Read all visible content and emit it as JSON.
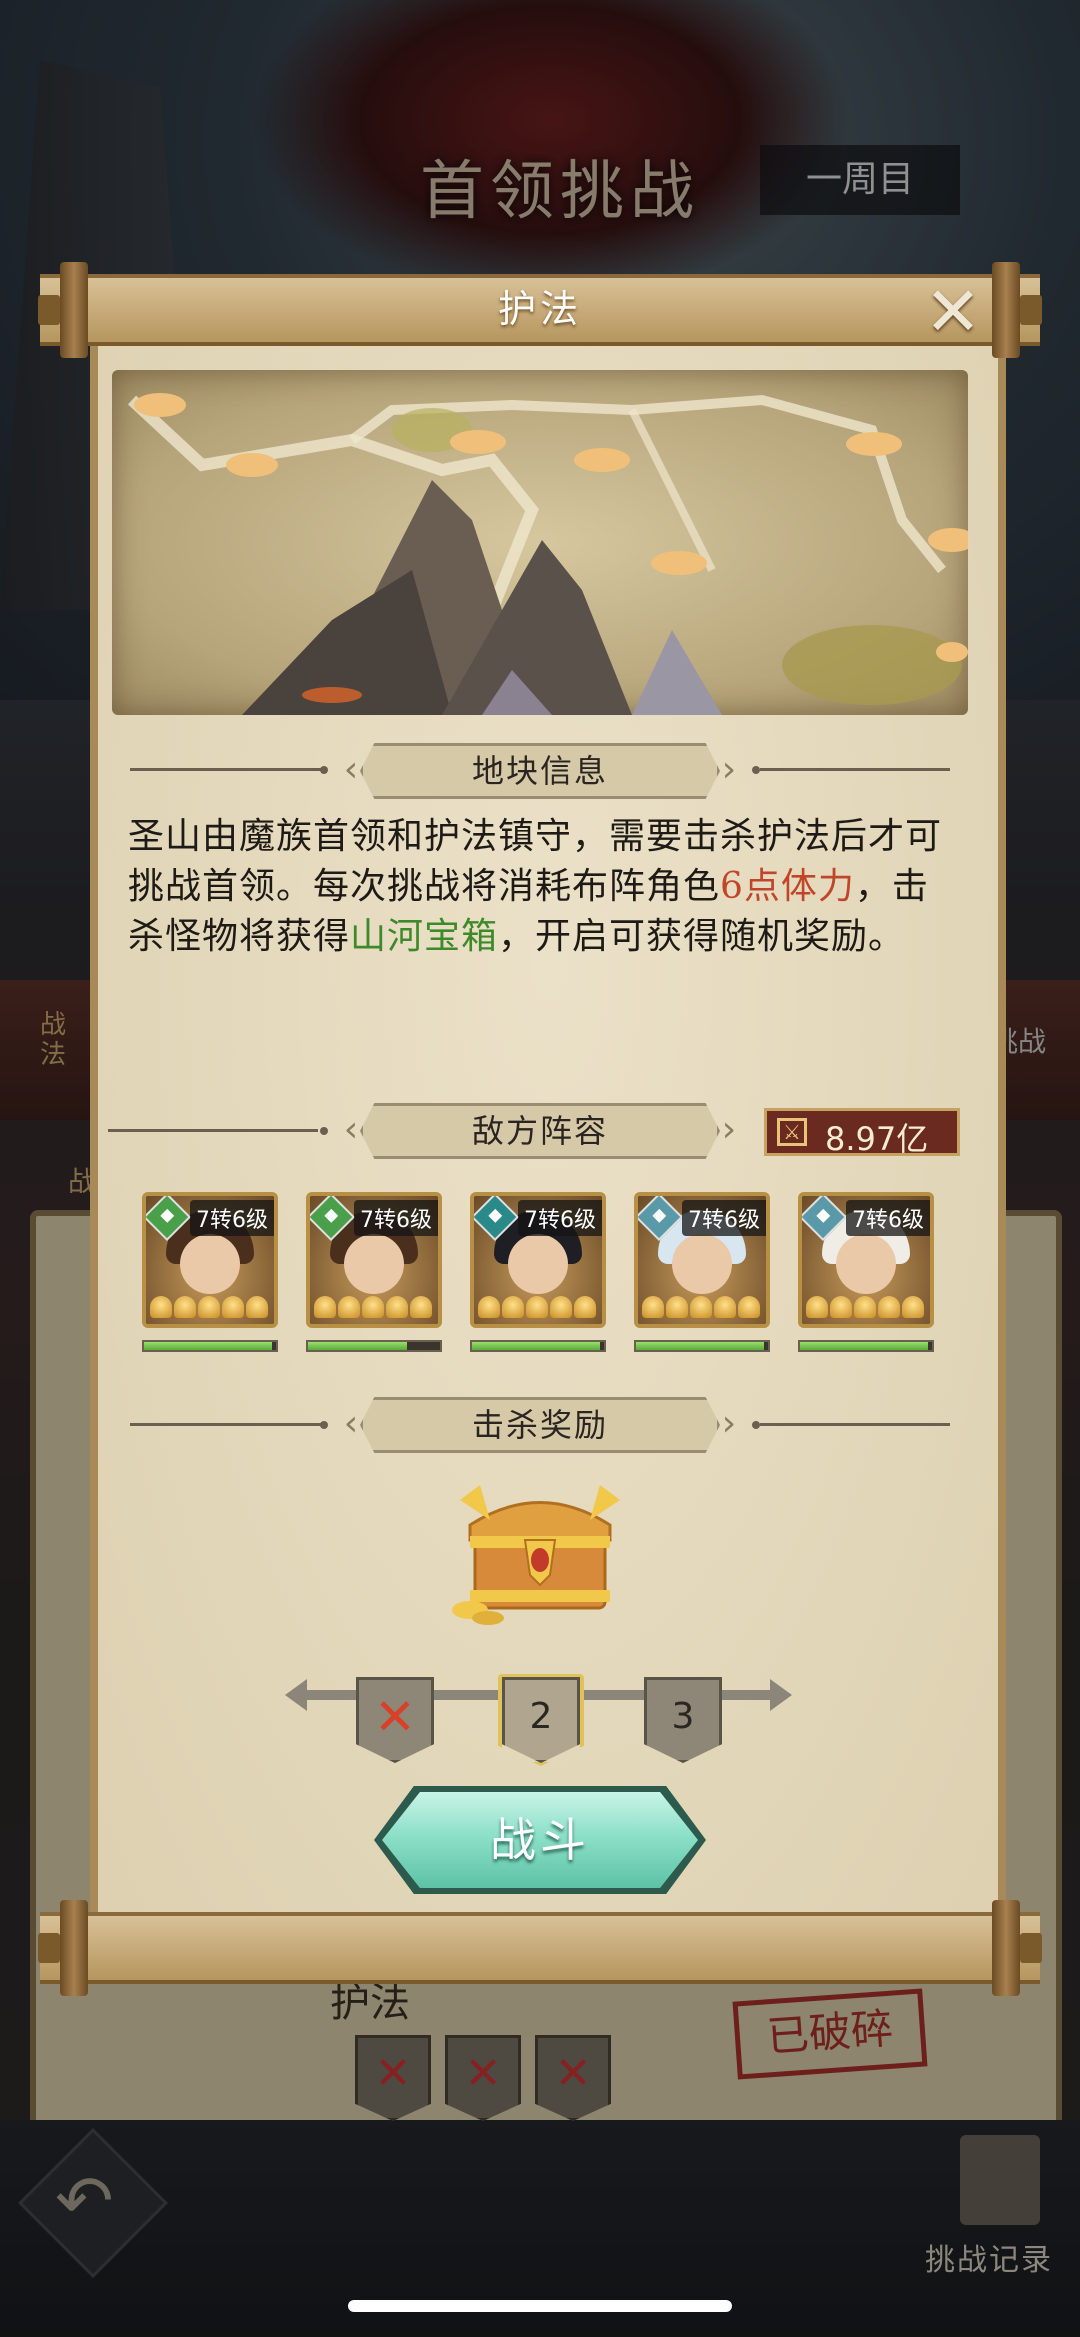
{
  "background": {
    "title": "首领挑战",
    "round": "一周目",
    "left_label": "战法",
    "left_label2": "战",
    "challenge": "挑战",
    "section": "护法",
    "stamp": "已破碎",
    "record": "挑战记录"
  },
  "modal": {
    "title": "护法",
    "close_symbol": "✕"
  },
  "info_section": {
    "label": "地块信息",
    "text_1": "圣山由魔族首领和护法镇守，需要击杀护法后才可挑战首领。每次挑战将消耗布阵角色",
    "text_stamina": "6点体力",
    "text_2": "，击杀怪物将获得",
    "text_chest": "山河宝箱",
    "text_3": "，开启可获得随机奖励。"
  },
  "enemy_section": {
    "label": "敌方阵容",
    "power": "8.97亿",
    "heroes": [
      {
        "level": "7转6级",
        "element_color": "#4aa04a",
        "hair": "#4a2f1c",
        "hp": 0.97
      },
      {
        "level": "7转6级",
        "element_color": "#4aa04a",
        "hair": "#4a2f1c",
        "hp": 0.75
      },
      {
        "level": "7转6级",
        "element_color": "#2a8a8a",
        "hair": "#1e1e24",
        "hp": 0.97
      },
      {
        "level": "7转6级",
        "element_color": "#5a9aa8",
        "hair": "#d8e6f0",
        "hp": 0.97
      },
      {
        "level": "7转6级",
        "element_color": "#5a9aa8",
        "hair": "#f0ece6",
        "hp": 0.97
      }
    ]
  },
  "reward_section": {
    "label": "击杀奖励"
  },
  "stages": [
    {
      "label": "✕",
      "state": "done"
    },
    {
      "label": "2",
      "state": "current"
    },
    {
      "label": "3",
      "state": "locked"
    }
  ],
  "fight_button": "战斗",
  "bg_shields": [
    "✕",
    "✕",
    "✕"
  ]
}
